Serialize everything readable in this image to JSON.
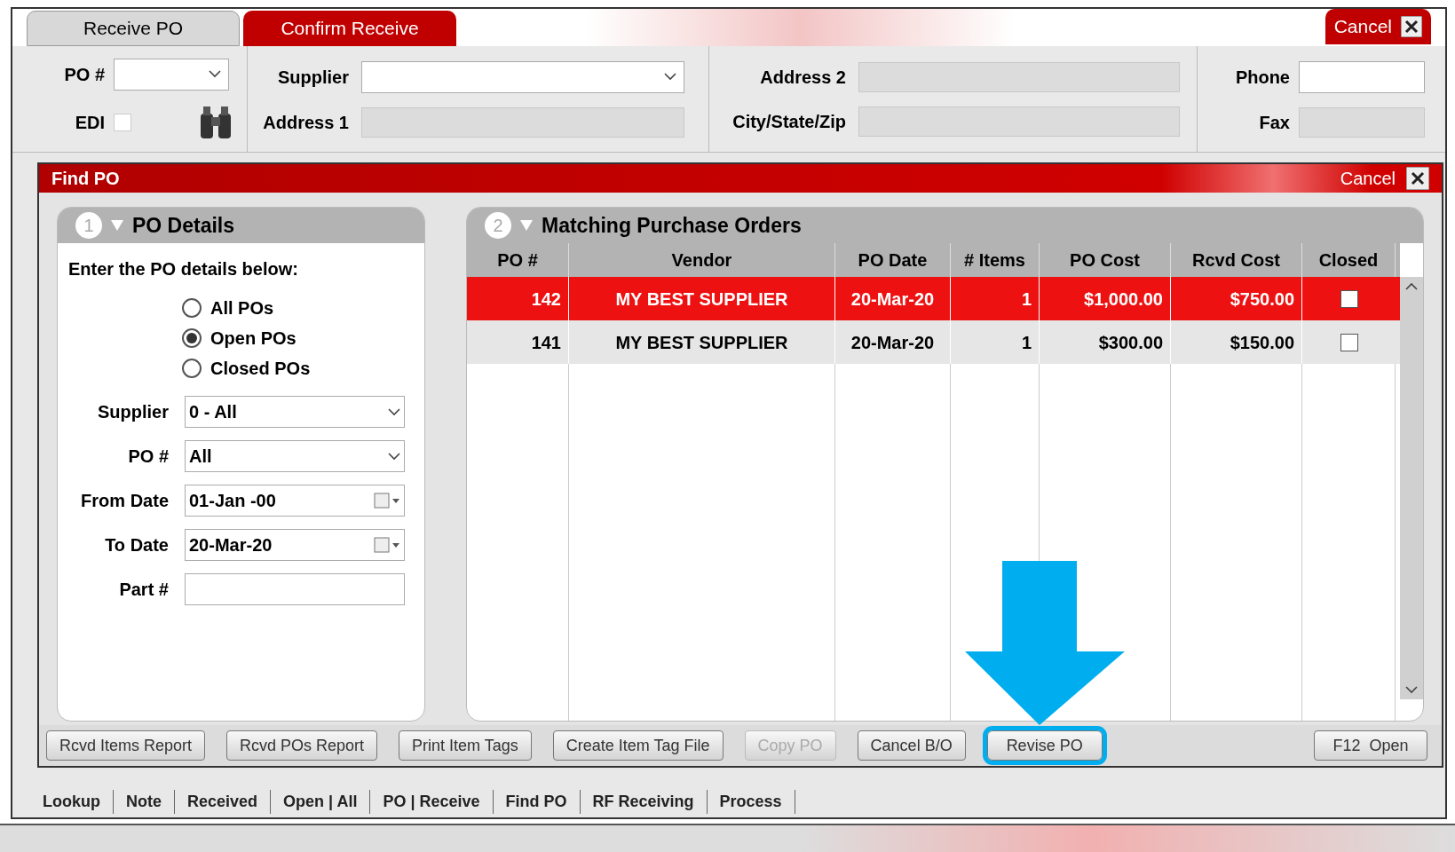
{
  "tabs": [
    {
      "label": "Receive PO",
      "selected": true
    },
    {
      "label": "Confirm Receive",
      "selected": false
    }
  ],
  "top_cancel": "Cancel",
  "header": {
    "po_label": "PO #",
    "edi_label": "EDI",
    "edi_checked": false,
    "supplier_label": "Supplier",
    "address1_label": "Address 1",
    "address2_label": "Address 2",
    "city_label": "City/State/Zip",
    "phone_label": "Phone",
    "fax_label": "Fax"
  },
  "dialog": {
    "title": "Find PO",
    "cancel": "Cancel",
    "details": {
      "number": "1",
      "title": "PO Details",
      "intro": "Enter the PO details below:",
      "options": [
        {
          "label": "All POs",
          "selected": false
        },
        {
          "label": "Open POs",
          "selected": true
        },
        {
          "label": "Closed POs",
          "selected": false
        }
      ],
      "fields": [
        {
          "kind": "select",
          "label": "Supplier",
          "value": "0 - All"
        },
        {
          "kind": "select",
          "label": "PO #",
          "value": "All"
        },
        {
          "kind": "date",
          "label": "From Date",
          "value": "01-Jan -00"
        },
        {
          "kind": "date",
          "label": "To Date",
          "value": "20-Mar-20"
        },
        {
          "kind": "text",
          "label": "Part #"
        }
      ]
    },
    "orders": {
      "number": "2",
      "title": "Matching Purchase Orders",
      "columns": [
        "PO #",
        "Vendor",
        "PO Date",
        "# Items",
        "PO Cost",
        "Rcvd Cost",
        "Closed"
      ],
      "rows": [
        {
          "po": "142",
          "vendor": "MY BEST SUPPLIER",
          "date": "20-Mar-20",
          "items": "1",
          "cost": "$1,000.00",
          "rcvd": "$750.00",
          "closed": false,
          "selected": true
        },
        {
          "po": "141",
          "vendor": "MY BEST SUPPLIER",
          "date": "20-Mar-20",
          "items": "1",
          "cost": "$300.00",
          "rcvd": "$150.00",
          "closed": false,
          "selected": false
        }
      ]
    },
    "buttons": [
      {
        "label": "Rcvd Items Report",
        "disabled": false,
        "highlighted": false
      },
      {
        "label": "Rcvd POs Report",
        "disabled": false,
        "highlighted": false
      },
      {
        "label": "Print Item Tags",
        "disabled": false,
        "highlighted": false
      },
      {
        "label": "Create Item Tag File",
        "disabled": false,
        "highlighted": false
      },
      {
        "label": "Copy PO",
        "disabled": true,
        "highlighted": false
      },
      {
        "label": "Cancel B/O",
        "disabled": false,
        "highlighted": false
      },
      {
        "label": "Revise PO",
        "disabled": false,
        "highlighted": true
      }
    ],
    "open_button": "F12  Open"
  },
  "back_tabs": [
    "Lookup",
    "Note",
    "Received",
    "Open | All",
    "PO | Receive",
    "Find PO",
    "RF Receiving",
    "Process"
  ]
}
